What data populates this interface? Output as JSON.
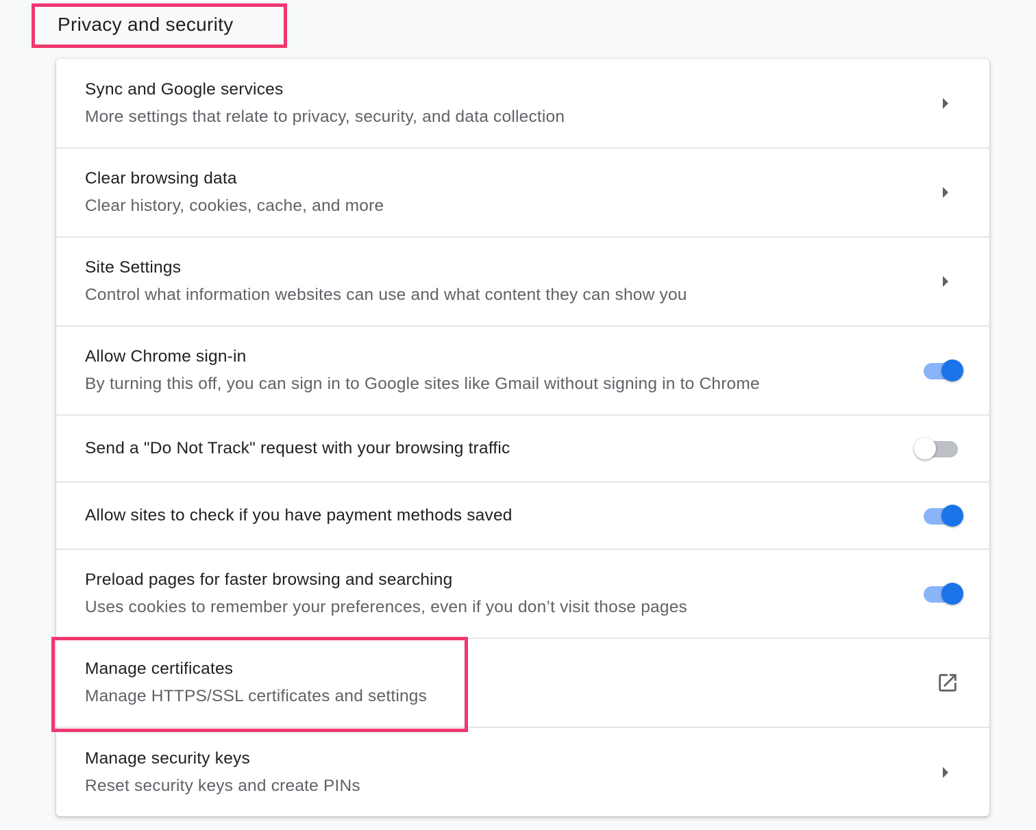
{
  "section": {
    "title": "Privacy and security"
  },
  "rows": [
    {
      "label": "Sync and Google services",
      "sub": "More settings that relate to privacy, security, and data collection",
      "control": "arrow"
    },
    {
      "label": "Clear browsing data",
      "sub": "Clear history, cookies, cache, and more",
      "control": "arrow"
    },
    {
      "label": "Site Settings",
      "sub": "Control what information websites can use and what content they can show you",
      "control": "arrow"
    },
    {
      "label": "Allow Chrome sign-in",
      "sub": "By turning this off, you can sign in to Google sites like Gmail without signing in to Chrome",
      "control": "toggle",
      "enabled": true
    },
    {
      "label": "Send a \"Do Not Track\" request with your browsing traffic",
      "control": "toggle",
      "enabled": false
    },
    {
      "label": "Allow sites to check if you have payment methods saved",
      "control": "toggle",
      "enabled": true
    },
    {
      "label": "Preload pages for faster browsing and searching",
      "sub": "Uses cookies to remember your preferences, even if you don’t visit those pages",
      "control": "toggle",
      "enabled": true
    },
    {
      "label": "Manage certificates",
      "sub": "Manage HTTPS/SSL certificates and settings",
      "control": "external-link"
    },
    {
      "label": "Manage security keys",
      "sub": "Reset security keys and create PINs",
      "control": "arrow"
    }
  ],
  "icons": {
    "arrow": "chevron-right-icon",
    "external": "open-in-new-icon"
  },
  "colors": {
    "highlight": "#f0376f",
    "toggle_on_knob": "#1a73e8",
    "toggle_on_track": "#8ab4f8",
    "toggle_off_track": "#bdc1c6",
    "background": "#f8f9fa"
  }
}
